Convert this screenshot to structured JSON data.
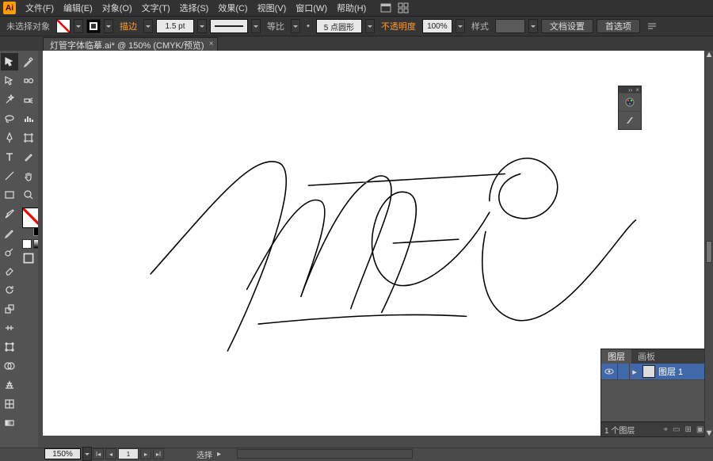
{
  "menu": {
    "file": "文件(F)",
    "edit": "编辑(E)",
    "object": "对象(O)",
    "type": "文字(T)",
    "select": "选择(S)",
    "effect": "效果(C)",
    "view": "视图(V)",
    "window": "窗口(W)",
    "help": "帮助(H)"
  },
  "ctrl": {
    "noSelection": "未选择对象",
    "strokeLabel": "描边",
    "strokeWeight": "1.5 pt",
    "uniform": "等比",
    "brushSize": "5 点圆形",
    "opacityLabel": "不透明度",
    "opacity": "100%",
    "styleLabel": "样式",
    "docSetup": "文档设置",
    "prefs": "首选项"
  },
  "doc": {
    "tabTitle": "灯管字体临摹.ai* @ 150% (CMYK/预览)"
  },
  "layers": {
    "tabLayers": "图层",
    "tabArtboards": "画板",
    "row1": "图层 1",
    "footer": "1 个图层"
  },
  "status": {
    "zoom": "150%",
    "tool": "选择"
  }
}
